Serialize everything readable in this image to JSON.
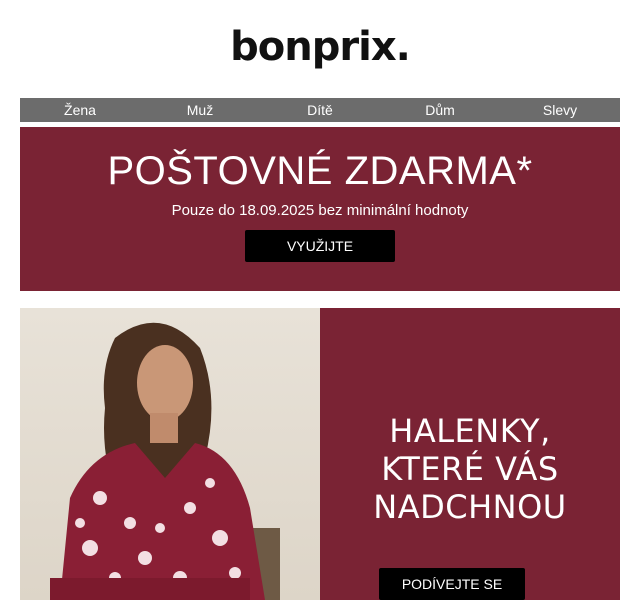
{
  "brand": {
    "logo_text": "bonprix."
  },
  "nav": {
    "items": [
      "Žena",
      "Muž",
      "Dítě",
      "Dům",
      "Slevy"
    ]
  },
  "promo": {
    "title": "POŠTOVNÉ ZDARMA*",
    "subtitle": "Pouze do 18.09.2025 bez minimální hodnoty",
    "button_label": "VYUŽIJTE"
  },
  "hero": {
    "headline": "HALENKY,\nKTERÉ VÁS\nNADCHNOU",
    "button_label": "PODÍVEJTE SE"
  },
  "colors": {
    "brand_burgundy": "#7a2334",
    "nav_gray": "#6c6c6c",
    "button_black": "#000000"
  }
}
